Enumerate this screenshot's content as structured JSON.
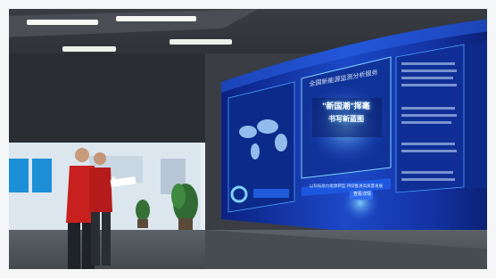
{
  "photo": {
    "scene": "control room with curved video wall",
    "wall_title": "全国新能源监测分析服务",
    "center_headline_1": "\"新国潮\"挥毫",
    "center_headline_2": "书写新蓝图",
    "lower_banner": "以科技助力能源转型 持续推进高质量发展",
    "right_panel_button": "查看详情",
    "colors": {
      "wall_deep": "#0a1e6e",
      "wall_mid": "#1b46c8",
      "wall_glow": "#4aa3ff",
      "vest_red": "#c8201f",
      "ceiling": "#2c2f33",
      "floor": "#4a4f56"
    }
  }
}
